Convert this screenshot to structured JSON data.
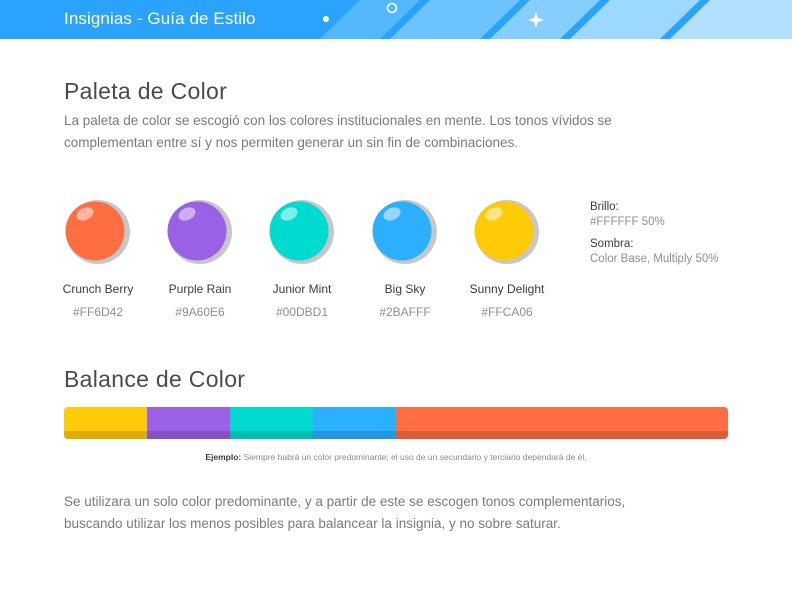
{
  "header": {
    "title": "Insignias - Guía de Estilo",
    "color": "#29A3FB"
  },
  "palette": {
    "heading": "Paleta de Color",
    "description_line1": "La paleta de color se escogió con los colores institucionales en mente. Los tonos vívidos se",
    "description_line2": "complementan entre sí y nos permiten generar un sin fin de combinaciones.",
    "colors": [
      {
        "name": "Crunch Berry",
        "hex": "#FF6D42"
      },
      {
        "name": "Purple Rain",
        "hex": "#9A60E6"
      },
      {
        "name": "Junior Mint",
        "hex": "#00DBD1"
      },
      {
        "name": "Big Sky",
        "hex": "#2BAFFF"
      },
      {
        "name": "Sunny Delight",
        "hex": "#FFCA06"
      }
    ],
    "notes": {
      "highlight_label": "Brillo:",
      "highlight_value": "#FFFFFF 50%",
      "shadow_label": "Sombra:",
      "shadow_value": "Color Base, Multiply 50%"
    }
  },
  "balance": {
    "heading": "Balance de Color",
    "segments": [
      {
        "color": "#FFCA06",
        "share": 0.125
      },
      {
        "color": "#9A60E6",
        "share": 0.125
      },
      {
        "color": "#00DBD1",
        "share": 0.125
      },
      {
        "color": "#2BAFFF",
        "share": 0.125
      },
      {
        "color": "#FF6D42",
        "share": 0.5
      }
    ],
    "caption_label": "Ejemplo:",
    "caption_text": " Siempre habrá un color predominante; el uso de un secundario y terciario dependará de él.",
    "body_line1": "Se utilizara un solo color predominante, y a partir de este se escogen tonos complementarios,",
    "body_line2": "buscando utilizar los menos posibles para balancear la insignia, y no sobre saturar."
  }
}
